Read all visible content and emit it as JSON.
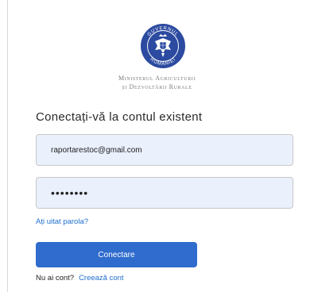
{
  "logo": {
    "seal_text_top": "GUVERNUL",
    "seal_text_bottom": "ROMÂNIEI",
    "colors": {
      "seal": "#2b4aa0",
      "ring": "#ffffff"
    }
  },
  "ministry": {
    "line1": "Ministerul Agriculturii",
    "line2": "și Dezvoltării Rurale"
  },
  "login": {
    "title": "Conectați-vă la contul existent",
    "email_value": "raportarestoc@gmail.com",
    "password_value": "••••••••",
    "forgot_link": "Ați uitat parola?",
    "submit_label": "Conectare",
    "no_account_text": "Nu ai cont?",
    "create_account_link": "Creează cont"
  },
  "colors": {
    "accent": "#2f6ccd",
    "link": "#1e6fd0",
    "field_bg": "#eaf0fc"
  }
}
